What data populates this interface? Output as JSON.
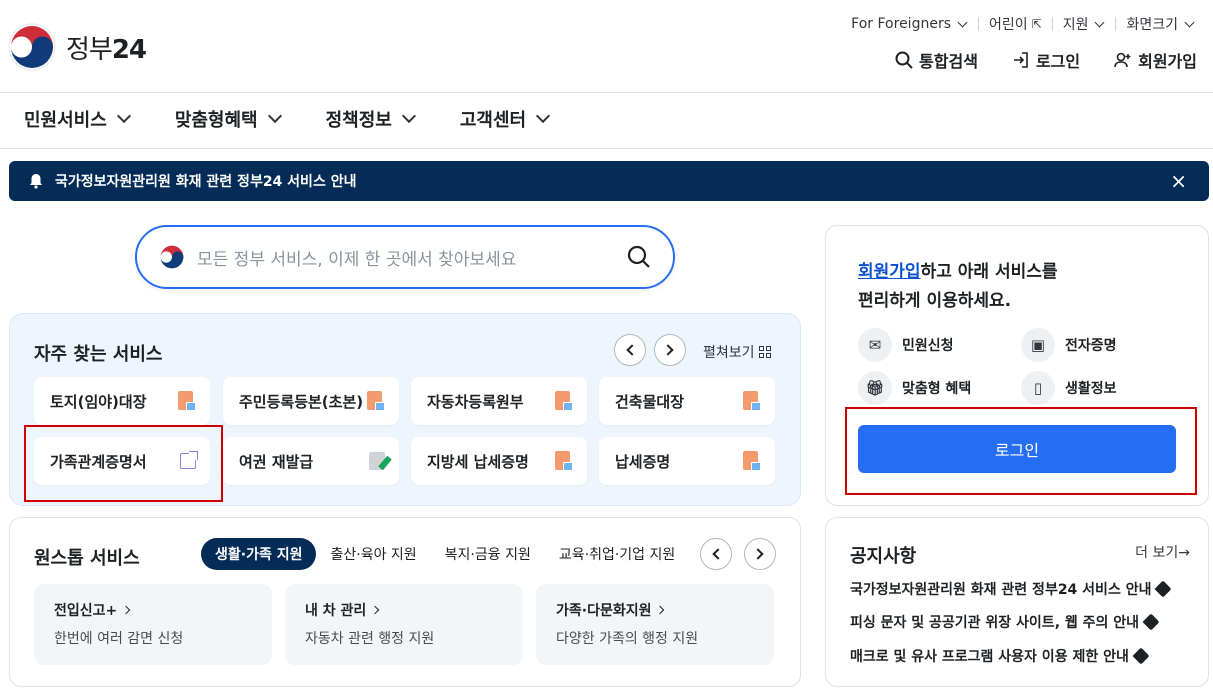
{
  "logo": {
    "text": "정부",
    "num": "24"
  },
  "util_links": [
    {
      "label": "For Foreigners"
    },
    {
      "label": "어린이"
    },
    {
      "label": "지원"
    },
    {
      "label": "화면크기"
    }
  ],
  "tools": {
    "search": "통합검색",
    "login": "로그인",
    "join": "회원가입"
  },
  "gnb": [
    "민원서비스",
    "맞춤형혜택",
    "정책정보",
    "고객센터"
  ],
  "banner": {
    "text": "국가정보자원관리원 화재 관련 정부24 서비스 안내",
    "close": "×"
  },
  "search": {
    "placeholder": "모든 정부 서비스, 이제 한 곳에서 찾아보세요"
  },
  "frequent": {
    "title": "자주 찾는 서비스",
    "expand": "펼쳐보기",
    "items": [
      "토지(임야)대장",
      "주민등록등본(초본)",
      "자동차등록원부",
      "건축물대장",
      "가족관계증명서",
      "여권 재발급",
      "지방세 납세증명",
      "납세증명"
    ]
  },
  "login_panel": {
    "link": "회원가입",
    "msg1": "하고 아래 서비스를",
    "msg2": "편리하게 이용하세요.",
    "services": [
      "민원신청",
      "전자증명",
      "맞춤형 혜택",
      "생활정보"
    ],
    "button": "로그인"
  },
  "onestop": {
    "title": "원스톱 서비스",
    "tabs": [
      "생활·가족 지원",
      "출산·육아 지원",
      "복지·금융 지원",
      "교육·취업·기업 지원"
    ],
    "cards": [
      {
        "title": "전입신고+",
        "desc": "한번에 여러 감면 신청"
      },
      {
        "title": "내 차 관리",
        "desc": "자동차 관련 행정 지원"
      },
      {
        "title": "가족·다문화지원",
        "desc": "다양한 가족의 행정 지원"
      }
    ]
  },
  "notice": {
    "title": "공지사항",
    "more": "더 보기→",
    "items": [
      "국가정보자원관리원 화재 관련 정부24 서비스 안내",
      "피싱 문자 및 공공기관 위장 사이트, 웹 주의 안내",
      "매크로 및 유사 프로그램 사용자 이용 제한 안내"
    ]
  },
  "colors": {
    "accent": "#256ef4",
    "navy": "#052b57",
    "highlight": "#d10000"
  }
}
